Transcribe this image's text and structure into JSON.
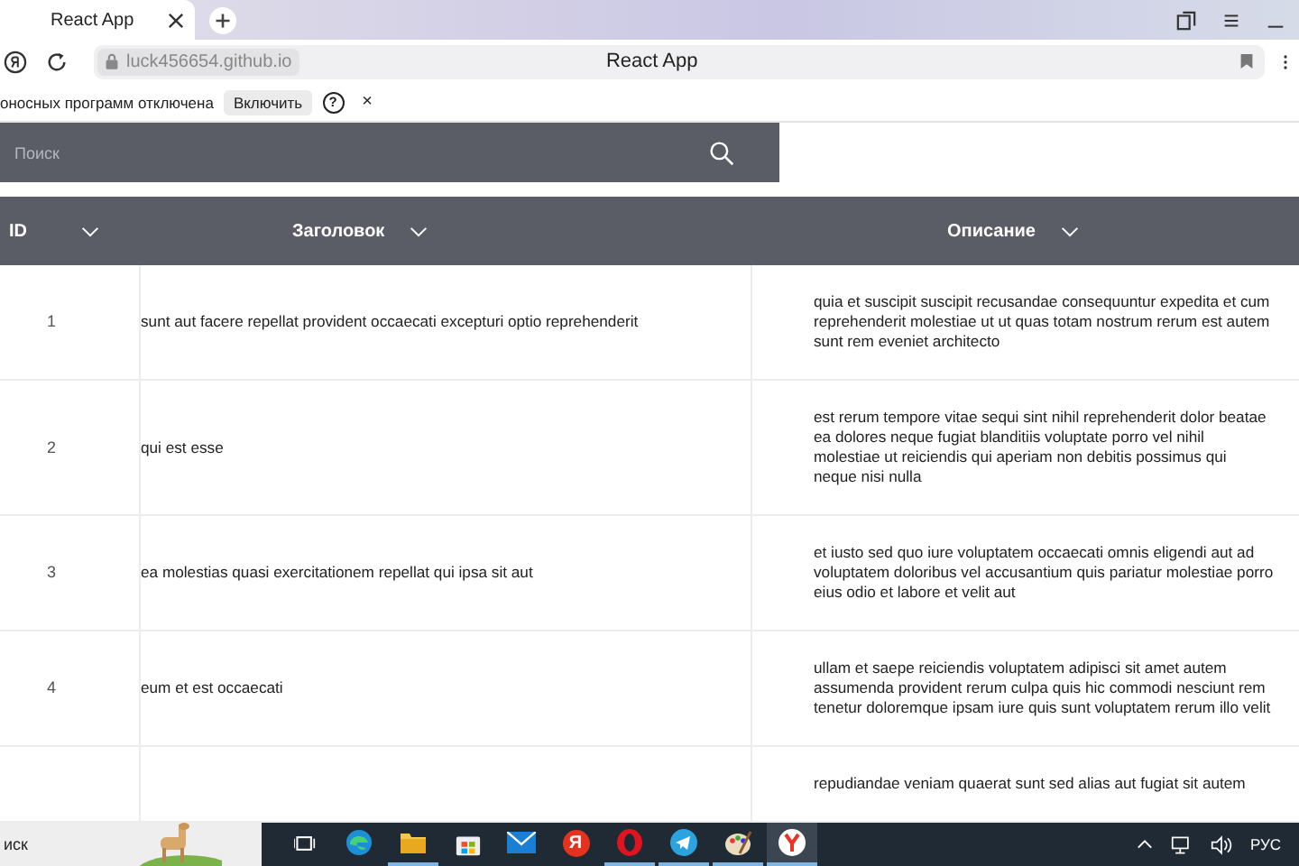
{
  "browser": {
    "tab_title": "React App",
    "address": "luck456654.github.io",
    "page_title": "React App"
  },
  "infobar": {
    "message": "оносных программ отключена",
    "button": "Включить",
    "help": "?",
    "close": "×"
  },
  "search": {
    "placeholder": "Поиск"
  },
  "table": {
    "columns": [
      "ID",
      "Заголовок",
      "Описание"
    ],
    "rows": [
      {
        "id": "1",
        "title": "sunt aut facere repellat provident occaecati excepturi optio reprehenderit",
        "body": "quia et suscipit suscipit recusandae consequuntur expedita et cum reprehenderit molestiae ut ut quas totam nostrum rerum est autem sunt rem eveniet architecto"
      },
      {
        "id": "2",
        "title": "qui est esse",
        "body": "est rerum tempore vitae sequi sint nihil reprehenderit dolor beatae ea dolores neque fugiat blanditiis voluptate porro vel nihil molestiae ut reiciendis qui aperiam non debitis possimus qui neque nisi nulla"
      },
      {
        "id": "3",
        "title": "ea molestias quasi exercitationem repellat qui ipsa sit aut",
        "body": "et iusto sed quo iure voluptatem occaecati omnis eligendi aut ad voluptatem doloribus vel accusantium quis pariatur molestiae porro eius odio et labore et velit aut"
      },
      {
        "id": "4",
        "title": "eum et est occaecati",
        "body": "ullam et saepe reiciendis voluptatem adipisci sit amet autem assumenda provident rerum culpa quis hic commodi nesciunt rem tenetur doloremque ipsam iure quis sunt voluptatem rerum illo velit"
      },
      {
        "body": "repudiandae veniam quaerat sunt sed alias aut fugiat sit autem"
      }
    ]
  },
  "taskbar": {
    "search": "иск",
    "apps": [
      {
        "kind": "taskview",
        "running": false,
        "selected": false
      },
      {
        "kind": "edge",
        "running": false,
        "selected": false
      },
      {
        "kind": "folder",
        "running": true,
        "selected": false
      },
      {
        "kind": "store",
        "running": false,
        "selected": false
      },
      {
        "kind": "mail",
        "running": false,
        "selected": false
      },
      {
        "kind": "yandex",
        "label": "Я",
        "running": false,
        "selected": false
      },
      {
        "kind": "opera",
        "running": true,
        "selected": false
      },
      {
        "kind": "telegram",
        "running": true,
        "selected": false
      },
      {
        "kind": "paint",
        "running": true,
        "selected": false
      },
      {
        "kind": "ybrowser",
        "running": true,
        "selected": true
      }
    ],
    "language": "РУС"
  }
}
